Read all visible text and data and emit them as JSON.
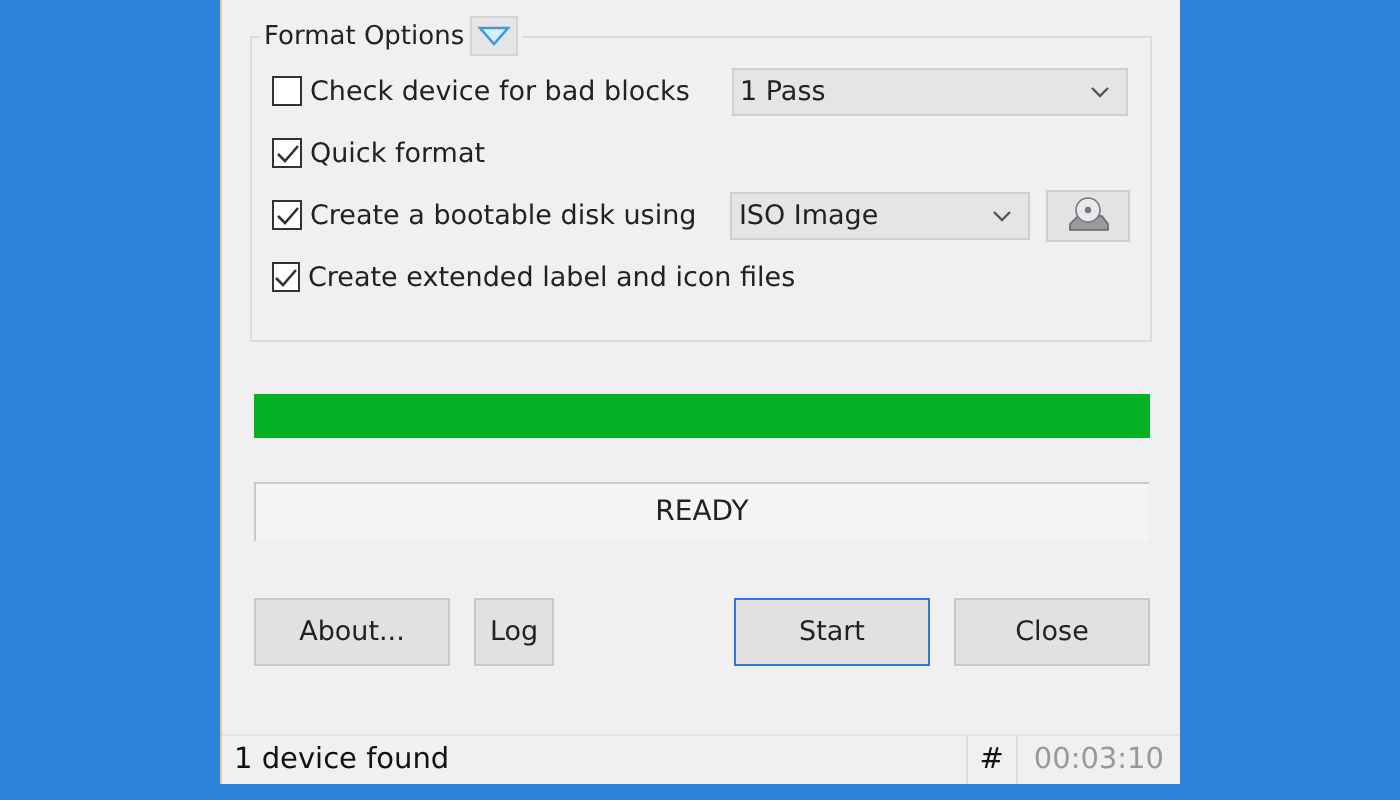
{
  "format_options": {
    "title": "Format Options",
    "expanded": true,
    "options": [
      {
        "label": "Check device for bad blocks",
        "checked": false,
        "dropdown": "1 Pass"
      },
      {
        "label": "Quick format",
        "checked": true
      },
      {
        "label": "Create a bootable disk using",
        "checked": true,
        "dropdown": "ISO Image",
        "has_image_button": true
      },
      {
        "label": "Create extended label and icon files",
        "checked": true
      }
    ]
  },
  "progress": {
    "level": 1
  },
  "status": "READY",
  "buttons": [
    {
      "label": "About...",
      "kind": "left"
    },
    {
      "label": "Log",
      "kind": "left"
    },
    {
      "label": "Start",
      "kind": "right",
      "focused": true
    },
    {
      "label": "Close",
      "kind": "right",
      "focused": false
    }
  ],
  "status_bar": {
    "text": "1 device found",
    "hash": "#",
    "time": "00:03:10"
  }
}
